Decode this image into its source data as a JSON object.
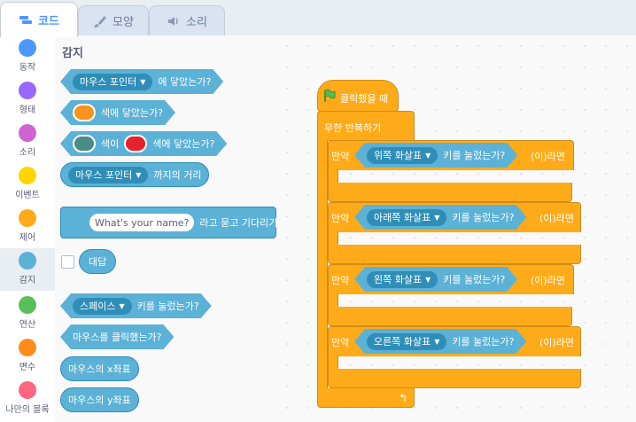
{
  "tabs": [
    {
      "label": "코드",
      "icon": "code-icon"
    },
    {
      "label": "모양",
      "icon": "brush-icon"
    },
    {
      "label": "소리",
      "icon": "speaker-icon"
    }
  ],
  "categories": [
    {
      "label": "동작",
      "color": "#4c97ff"
    },
    {
      "label": "형태",
      "color": "#9966ff"
    },
    {
      "label": "소리",
      "color": "#cf63cf"
    },
    {
      "label": "이벤트",
      "color": "#ffd500"
    },
    {
      "label": "제어",
      "color": "#ffab19"
    },
    {
      "label": "감지",
      "color": "#5cb1d6"
    },
    {
      "label": "연산",
      "color": "#59c059"
    },
    {
      "label": "변수",
      "color": "#ff8c1a"
    },
    {
      "label": "나만의 블록",
      "color": "#ff6680"
    }
  ],
  "palette": {
    "title": "감지",
    "touching": {
      "dropdown": "마우스 포인터",
      "suffix": "에 닿았는가?"
    },
    "touching_color": {
      "suffix": "색에 닿았는가?",
      "color": "#f7941d"
    },
    "color_touching": {
      "mid": "색이",
      "suffix": "색에 닿았는가?",
      "color1": "#4a8c86",
      "color2": "#e8212b"
    },
    "distance": {
      "dropdown": "마우스 포인터",
      "suffix": "까지의 거리"
    },
    "ask": {
      "input": "What's your name?",
      "suffix": "라고 묻고 기다리기"
    },
    "answer": "대답",
    "keypressed": {
      "dropdown": "스페이스",
      "suffix": "키를 눌렀는가?"
    },
    "mousedown": "마우스를 클릭했는가?",
    "mousex": "마우스의 x좌표",
    "mousey": "마우스의 y좌표"
  },
  "script": {
    "hat": "클릭했을 때",
    "forever": "무한 반복하기",
    "if_prefix": "만약",
    "if_suffix": "(이)라면",
    "key_suffix": "키를 눌렀는가?",
    "keys": [
      "위쪽 화살표",
      "아래쪽 화살표",
      "왼쪽 화살표",
      "오른쪽 화살표"
    ],
    "loop_icon": "loop-arrow-icon"
  }
}
